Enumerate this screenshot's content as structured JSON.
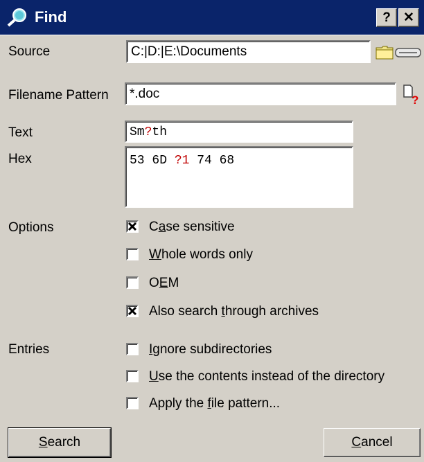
{
  "window": {
    "title": "Find",
    "help_button": "?",
    "close_button": "✕"
  },
  "source": {
    "label": "Source",
    "value": "C:|D:|E:\\Documents"
  },
  "filename_pattern": {
    "label": "Filename Pattern",
    "value": "*.doc"
  },
  "text": {
    "label": "Text",
    "value_parts": [
      "Sm",
      "?",
      "th"
    ]
  },
  "hex": {
    "label": "Hex",
    "value_parts": [
      "53 6D ",
      "?1",
      " 74 68"
    ]
  },
  "options": {
    "label": "Options",
    "items": [
      {
        "pre": "C",
        "u": "a",
        "post": "se sensitive",
        "checked": true
      },
      {
        "pre": "",
        "u": "W",
        "post": "hole words only",
        "checked": false
      },
      {
        "pre": "O",
        "u": "E",
        "post": "M",
        "checked": false
      },
      {
        "pre": "Also search ",
        "u": "t",
        "post": "hrough archives",
        "checked": true
      }
    ]
  },
  "entries": {
    "label": "Entries",
    "items": [
      {
        "pre": "",
        "u": "I",
        "post": "gnore subdirectories",
        "checked": false
      },
      {
        "pre": "",
        "u": "U",
        "post": "se the contents instead of the directory",
        "checked": false
      },
      {
        "pre": "Apply the ",
        "u": "f",
        "post": "ile pattern...",
        "checked": false
      }
    ]
  },
  "buttons": {
    "search": {
      "u": "S",
      "post": "earch"
    },
    "cancel": {
      "u": "C",
      "post": "ancel"
    }
  },
  "icons": {
    "title": "find-magnifier-icon",
    "browse": "folder-icon",
    "drive": "drive-icon",
    "pattern_help": "file-pattern-help-icon"
  },
  "colors": {
    "titlebar": "#0a246a",
    "wildcard": "#c00000",
    "face": "#d4d0c8"
  }
}
